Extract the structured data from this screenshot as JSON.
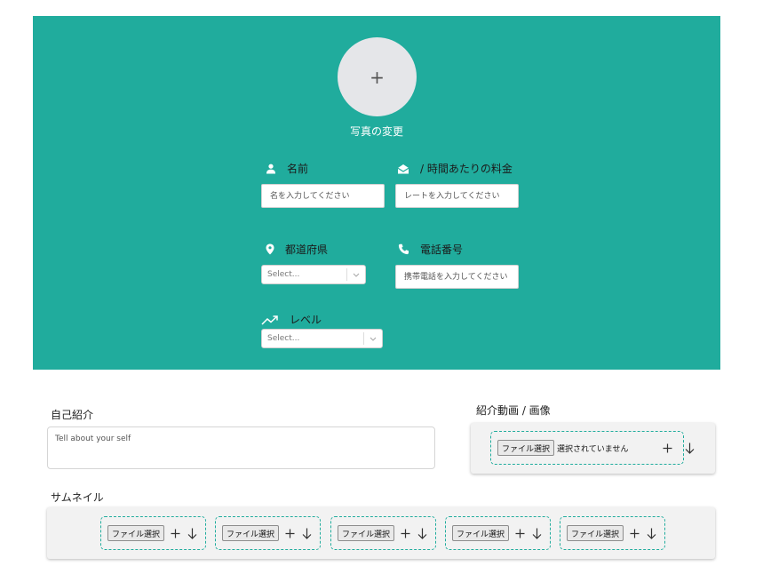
{
  "profile": {
    "photo_change_label": "写真の変更",
    "avatar_symbol": "+"
  },
  "fields": {
    "name": {
      "label": "名前",
      "placeholder": "名を入力してください"
    },
    "rate": {
      "label": "/ 時間あたりの料金",
      "placeholder": "レートを入力してください"
    },
    "prefecture": {
      "label": "都道府県",
      "selected": "Select..."
    },
    "phone": {
      "label": "電話番号",
      "placeholder": "携帯電話を入力してください"
    },
    "level": {
      "label": "レベル",
      "selected": "Select..."
    }
  },
  "bio": {
    "label": "自己紹介",
    "placeholder": "Tell about your self"
  },
  "media": {
    "label": "紹介動画 / 画像",
    "file_button": "ファイル選択",
    "file_status": "選択されていません"
  },
  "thumbnails": {
    "label": "サムネイル",
    "file_button": "ファイル選択",
    "count": 5
  },
  "colors": {
    "accent": "#20ac9d",
    "avatar_bg": "#e5e6e9",
    "panel_bg": "#f2f2f2"
  },
  "icons": {
    "name": "user-icon",
    "rate": "envelope-open-icon",
    "prefecture": "map-pin-icon",
    "phone": "phone-icon",
    "level": "trending-up-icon",
    "add": "plus-icon",
    "download": "arrow-down-icon",
    "dropdown": "chevron-down-icon"
  }
}
